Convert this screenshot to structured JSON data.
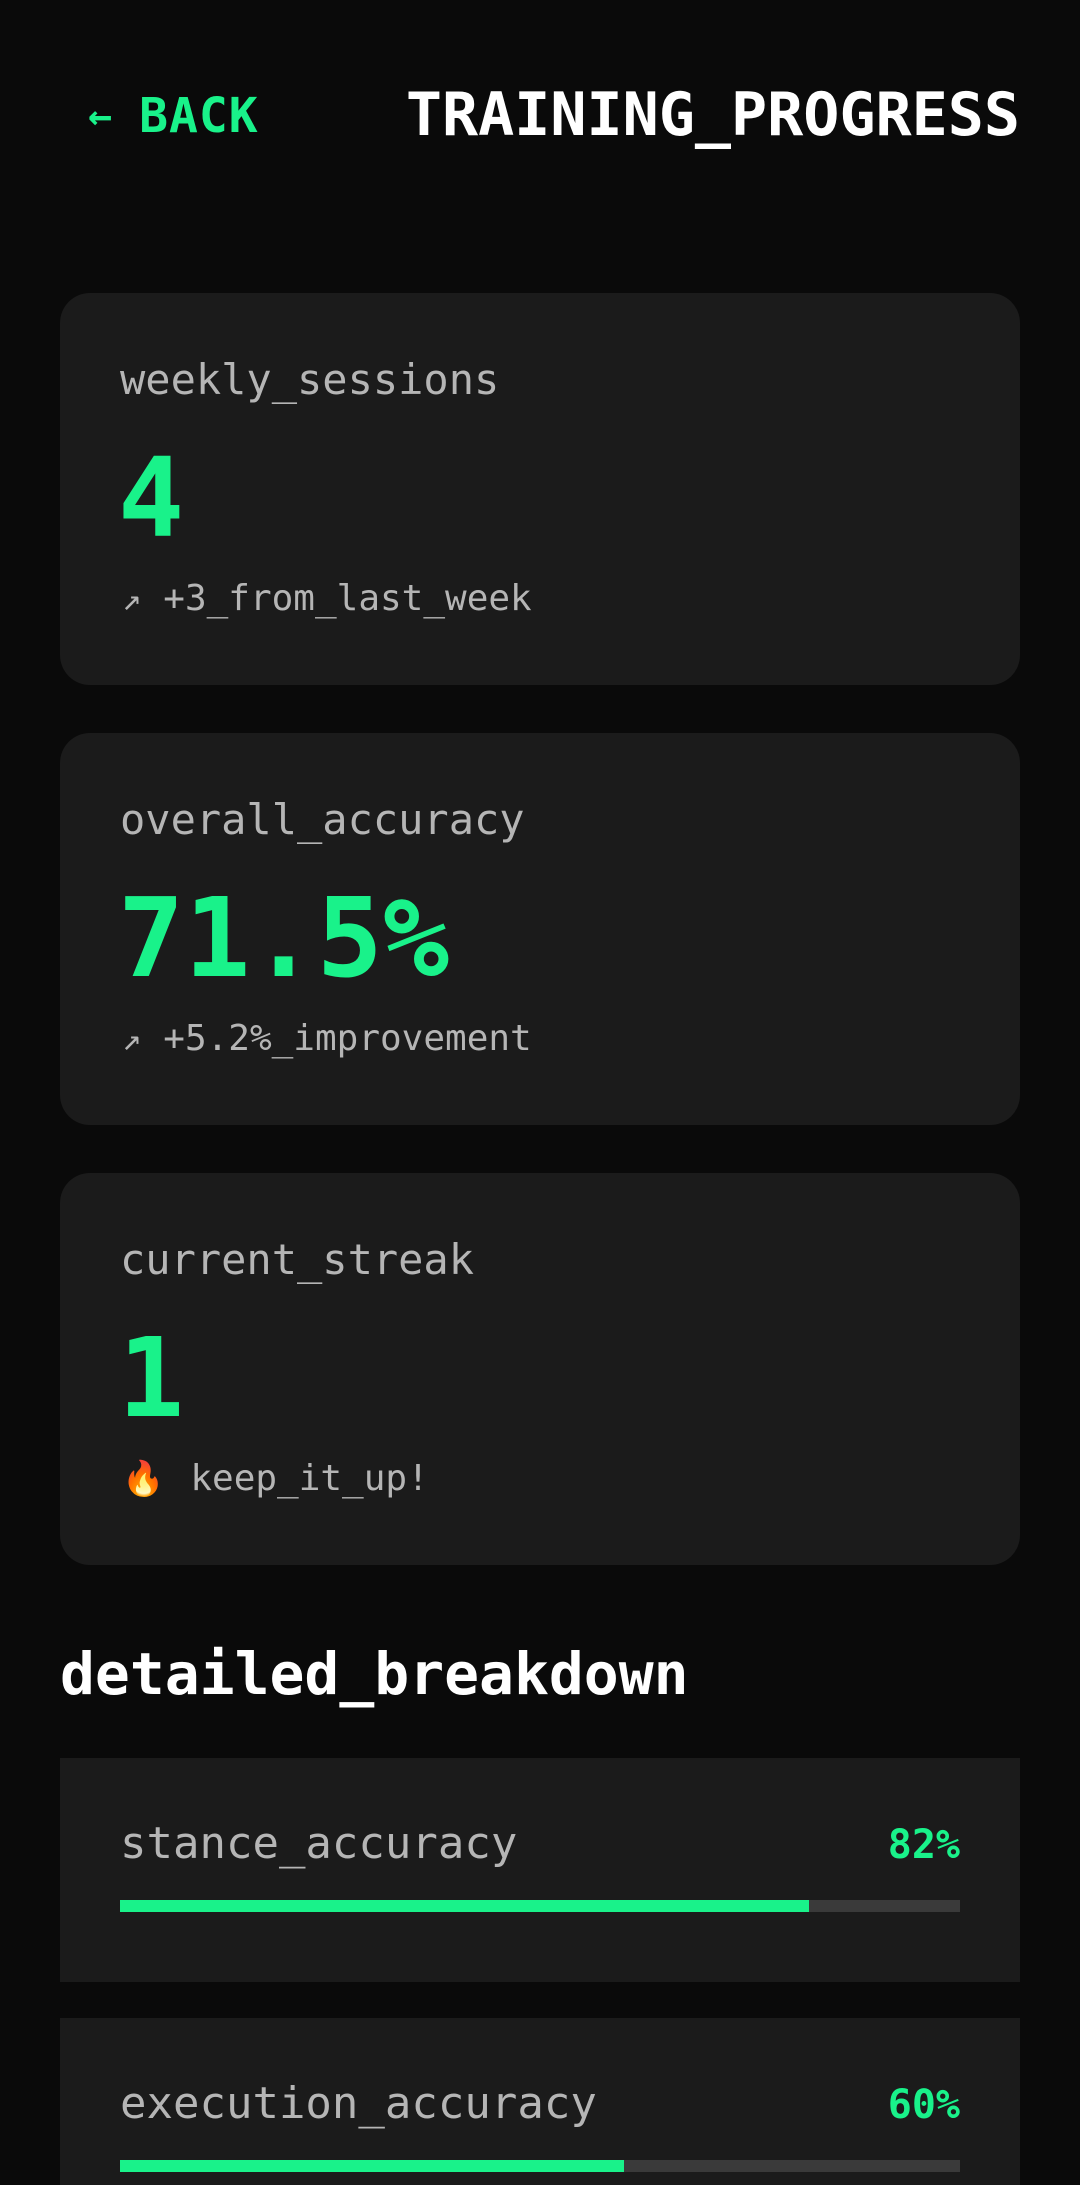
{
  "header": {
    "back_arrow": "←",
    "back_label": "BACK",
    "title": "TRAINING_PROGRESS"
  },
  "stats": {
    "weekly_sessions": {
      "label": "weekly_sessions",
      "value": "4",
      "note_icon": "↗",
      "note": "+3_from_last_week"
    },
    "overall_accuracy": {
      "label": "overall_accuracy",
      "value": "71.5%",
      "note_icon": "↗",
      "note": "+5.2%_improvement"
    },
    "current_streak": {
      "label": "current_streak",
      "value": "1",
      "note_icon": "🔥",
      "note": "keep_it_up!"
    }
  },
  "breakdown": {
    "title": "detailed_breakdown",
    "items": [
      {
        "label": "stance_accuracy",
        "value": "82%",
        "fraction": 0.82
      },
      {
        "label": "execution_accuracy",
        "value": "60%",
        "fraction": 0.6
      }
    ]
  },
  "colors": {
    "accent": "#19f28a",
    "background": "#0a0a0a",
    "card": "#1b1b1b",
    "muted_text": "#b5b5b5",
    "track": "#3a3a3a"
  },
  "icons": {
    "back": "arrow-left-icon",
    "trend": "trend-up-icon",
    "streak": "flame-icon"
  }
}
